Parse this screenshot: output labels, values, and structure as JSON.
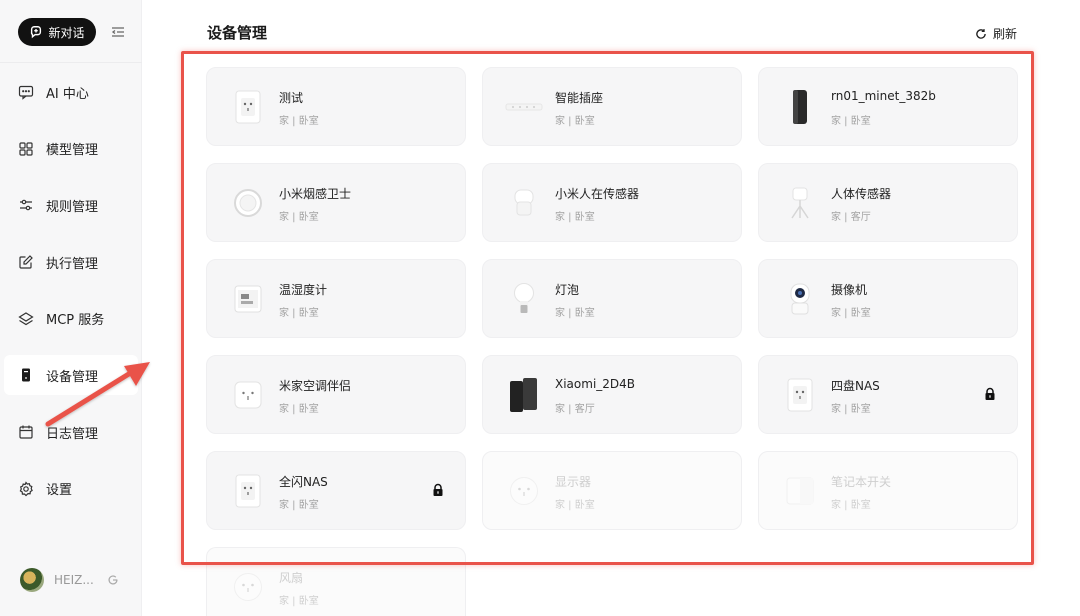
{
  "sidebar": {
    "new_chat_label": "新对话",
    "items": [
      {
        "label": "AI 中心",
        "icon": "chat-icon"
      },
      {
        "label": "模型管理",
        "icon": "grid-icon"
      },
      {
        "label": "规则管理",
        "icon": "sliders-icon"
      },
      {
        "label": "执行管理",
        "icon": "edit-icon"
      },
      {
        "label": "MCP 服务",
        "icon": "layers-icon"
      },
      {
        "label": "设备管理",
        "icon": "device-icon",
        "active": true
      },
      {
        "label": "日志管理",
        "icon": "calendar-icon"
      },
      {
        "label": "设置",
        "icon": "gear-icon"
      }
    ],
    "user_name": "HEIZ..."
  },
  "header": {
    "title": "设备管理",
    "refresh_label": "刷新"
  },
  "devices": [
    {
      "name": "测试",
      "location": "家 | 卧室",
      "icon": "smart-plug-icon",
      "locked": false,
      "disabled": false
    },
    {
      "name": "智能插座",
      "location": "家 | 卧室",
      "icon": "power-strip-icon",
      "locked": false,
      "disabled": false
    },
    {
      "name": "rn01_minet_382b",
      "location": "家 | 卧室",
      "icon": "router-icon",
      "locked": false,
      "disabled": false
    },
    {
      "name": "小米烟感卫士",
      "location": "家 | 卧室",
      "icon": "smoke-detector-icon",
      "locked": false,
      "disabled": false
    },
    {
      "name": "小米人在传感器",
      "location": "家 | 卧室",
      "icon": "presence-sensor-icon",
      "locked": false,
      "disabled": false
    },
    {
      "name": "人体传感器",
      "location": "家 | 客厅",
      "icon": "motion-sensor-icon",
      "locked": false,
      "disabled": false
    },
    {
      "name": "温湿度计",
      "location": "家 | 卧室",
      "icon": "thermometer-icon",
      "locked": false,
      "disabled": false
    },
    {
      "name": "灯泡",
      "location": "家 | 卧室",
      "icon": "bulb-icon",
      "locked": false,
      "disabled": false
    },
    {
      "name": "摄像机",
      "location": "家 | 卧室",
      "icon": "camera-icon",
      "locked": false,
      "disabled": false
    },
    {
      "name": "米家空调伴侣",
      "location": "家 | 卧室",
      "icon": "ac-companion-icon",
      "locked": false,
      "disabled": false
    },
    {
      "name": "Xiaomi_2D4B",
      "location": "家 | 客厅",
      "icon": "mesh-router-icon",
      "locked": false,
      "disabled": false
    },
    {
      "name": "四盘NAS",
      "location": "家 | 卧室",
      "icon": "smart-plug-icon",
      "locked": true,
      "disabled": false
    },
    {
      "name": "全闪NAS",
      "location": "家 | 卧室",
      "icon": "smart-plug-icon",
      "locked": true,
      "disabled": false
    },
    {
      "name": "显示器",
      "location": "家 | 卧室",
      "icon": "wall-socket-icon",
      "locked": false,
      "disabled": true
    },
    {
      "name": "笔记本开关",
      "location": "家 | 卧室",
      "icon": "switch-icon",
      "locked": false,
      "disabled": true
    },
    {
      "name": "风扇",
      "location": "家 | 卧室",
      "icon": "wall-socket-icon",
      "locked": false,
      "disabled": true
    }
  ],
  "colors": {
    "highlight": "#e9534a",
    "active_nav_bg": "#ffffff",
    "sidebar_bg": "#f7f7f8",
    "card_bg": "#f6f6f7"
  }
}
